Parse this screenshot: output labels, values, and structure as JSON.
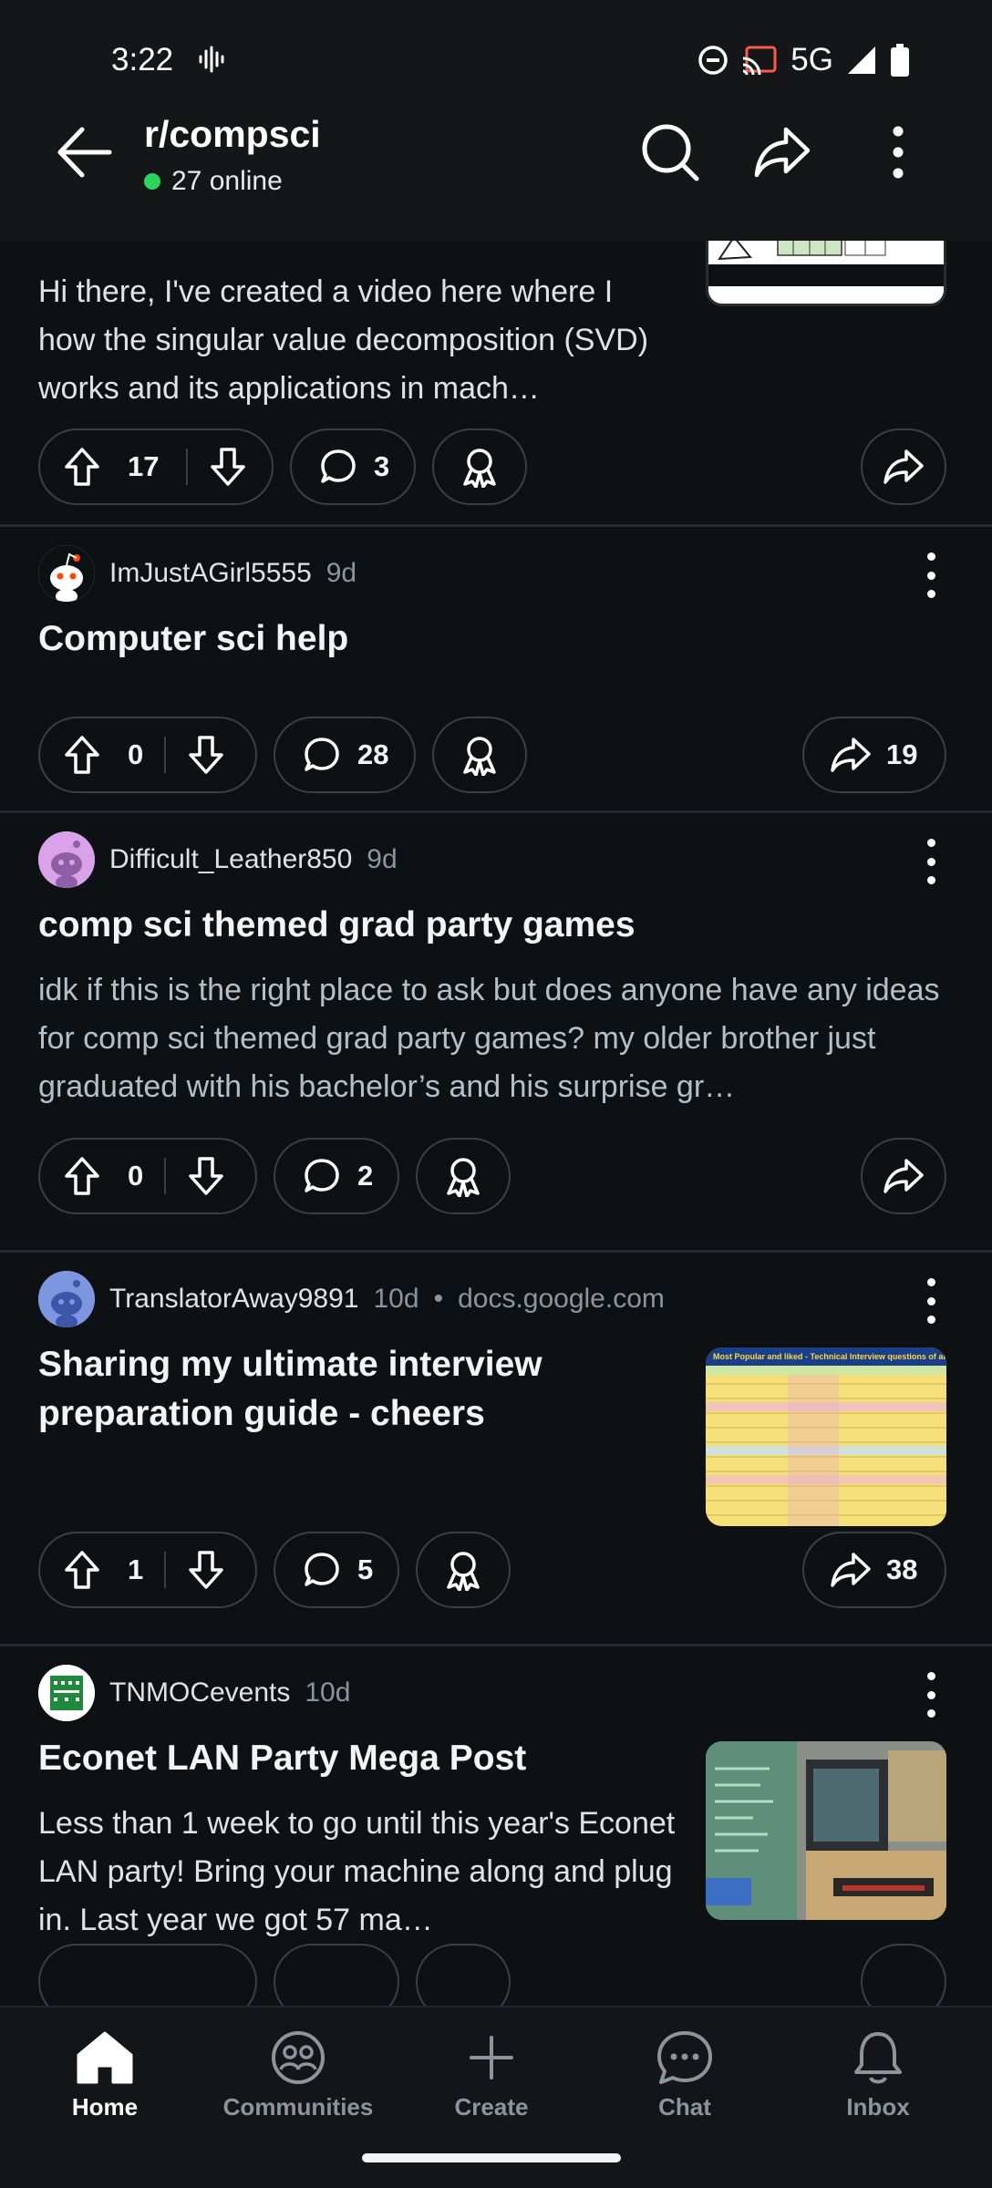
{
  "status_bar": {
    "time": "3:22",
    "network": "5G"
  },
  "header": {
    "subreddit": "r/compsci",
    "online": "27 online"
  },
  "posts": [
    {
      "body": "Hi there, I've created a video here where I how the singular value decomposition (SVD) works and its applications in mach…",
      "upvotes": "17",
      "comments": "3",
      "shares": ""
    },
    {
      "author": "ImJustAGirl5555",
      "age": "9d",
      "title": "Computer sci help",
      "upvotes": "0",
      "comments": "28",
      "shares": "19"
    },
    {
      "author": "Difficult_Leather850",
      "age": "9d",
      "title": "comp sci themed grad party games",
      "body": "idk if this is the right place to ask but does anyone have any ideas for comp sci themed grad party games? my older brother just graduated with his bachelor’s and his surprise gr…",
      "upvotes": "0",
      "comments": "2",
      "shares": ""
    },
    {
      "author": "TranslatorAway9891",
      "age": "10d",
      "domain": "docs.google.com",
      "title": "Sharing my ultimate interview preparation guide - cheers",
      "thumb_caption": "Most Popular and liked - Technical Interview questions of all time",
      "upvotes": "1",
      "comments": "5",
      "shares": "38"
    },
    {
      "author": "TNMOCevents",
      "age": "10d",
      "title": "Econet LAN Party Mega Post",
      "body": "Less than 1 week to go until this year's Econet LAN party! Bring your machine along and plug in. Last year we got 57 ma…"
    }
  ],
  "bottom_nav": {
    "home": "Home",
    "communities": "Communities",
    "create": "Create",
    "chat": "Chat",
    "inbox": "Inbox"
  },
  "colors": {
    "background": "#0e1113",
    "online_dot": "#2bd45c",
    "muted_text": "#8b959c"
  }
}
